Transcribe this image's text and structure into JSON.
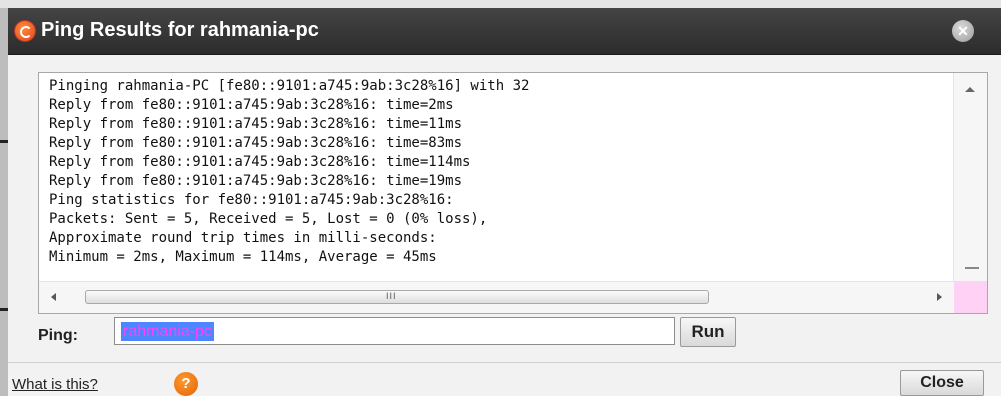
{
  "dialog": {
    "title": "Ping Results for rahmania-pc",
    "close_icon_glyph": "✕"
  },
  "output": {
    "text": "Pinging rahmania-PC [fe80::9101:a745:9ab:3c28%16] with 32\nReply from fe80::9101:a745:9ab:3c28%16: time=2ms\nReply from fe80::9101:a745:9ab:3c28%16: time=11ms\nReply from fe80::9101:a745:9ab:3c28%16: time=83ms\nReply from fe80::9101:a745:9ab:3c28%16: time=114ms\nReply from fe80::9101:a745:9ab:3c28%16: time=19ms\nPing statistics for fe80::9101:a745:9ab:3c28%16:\nPackets: Sent = 5, Received = 5, Lost = 0 (0% loss),\nApproximate round trip times in milli-seconds:\nMinimum = 2ms, Maximum = 114ms, Average = 45ms"
  },
  "scrollbar": {
    "grip": "III"
  },
  "ping": {
    "label": "Ping:",
    "value": "rahmania-pc",
    "run_label": "Run"
  },
  "footer": {
    "help_link": "What is this?",
    "help_icon_glyph": "?",
    "close_label": "Close"
  },
  "colors": {
    "titlebar": "#333333",
    "selection": "#4e86ff",
    "selected_text": "#ff40ff",
    "accent_orange": "#e3471a"
  }
}
